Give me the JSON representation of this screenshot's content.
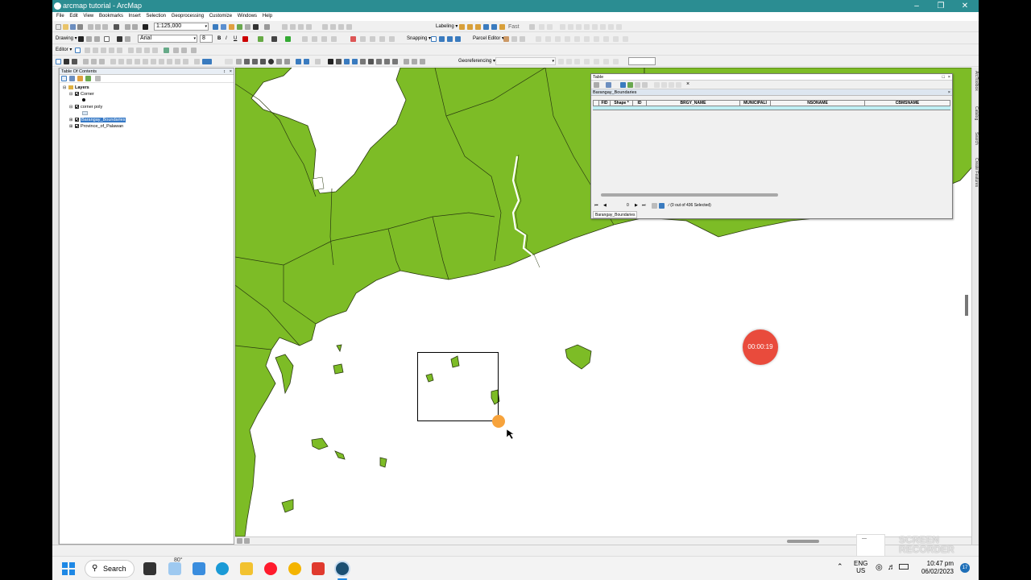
{
  "window": {
    "title": "arcmap tutorial - ArcMap"
  },
  "menu": [
    "File",
    "Edit",
    "View",
    "Bookmarks",
    "Insert",
    "Selection",
    "Geoprocessing",
    "Customize",
    "Windows",
    "Help"
  ],
  "toolbar": {
    "scale": "1:125,000",
    "labeling": "Labeling ▾",
    "fast": "Fast",
    "drawing": "Drawing ▾",
    "font": "Arial",
    "font_size": "8",
    "snapping": "Snapping ▾",
    "parcel_editor": "Parcel Editor ▾",
    "editor": "Editor ▾",
    "georeferencing": "Georeferencing ▾"
  },
  "toc": {
    "title": "Table Of Contents",
    "root": "Layers",
    "layers": [
      {
        "name": "Corner",
        "checked": true
      },
      {
        "name": "corner poly",
        "checked": true
      },
      {
        "name": "Barangay_Boundaries",
        "checked": true,
        "selected": true
      },
      {
        "name": "Province_of_Palawan",
        "checked": true
      }
    ]
  },
  "table": {
    "title": "Table",
    "layer_name": "Barangay_Boundaries",
    "columns": [
      "FID",
      "Shape *",
      "ID",
      "BRGY_NAME",
      "MUNICIPALI",
      "NSONAME",
      "CBMSNAME"
    ],
    "nav_value": "0",
    "selection_status": "(0 out of 436 Selected)",
    "tab_label": "Barangay_Boundaries"
  },
  "side_tabs": [
    "ArcToolbox",
    "Catalog",
    "Search",
    "Create Features"
  ],
  "recorder": {
    "timer": "00:00:19",
    "watermark": "SCREEN RECORDER"
  },
  "taskbar": {
    "search": "Search",
    "weather": "80°",
    "lang_top": "ENG",
    "lang_bottom": "US",
    "time": "10:47 pm",
    "date": "06/02/2023",
    "notifications": "17"
  },
  "colors": {
    "titlebar": "#2b8d92",
    "land": "#7dbc26",
    "recorder": "#e94b3c",
    "selection": "#3478c6"
  }
}
